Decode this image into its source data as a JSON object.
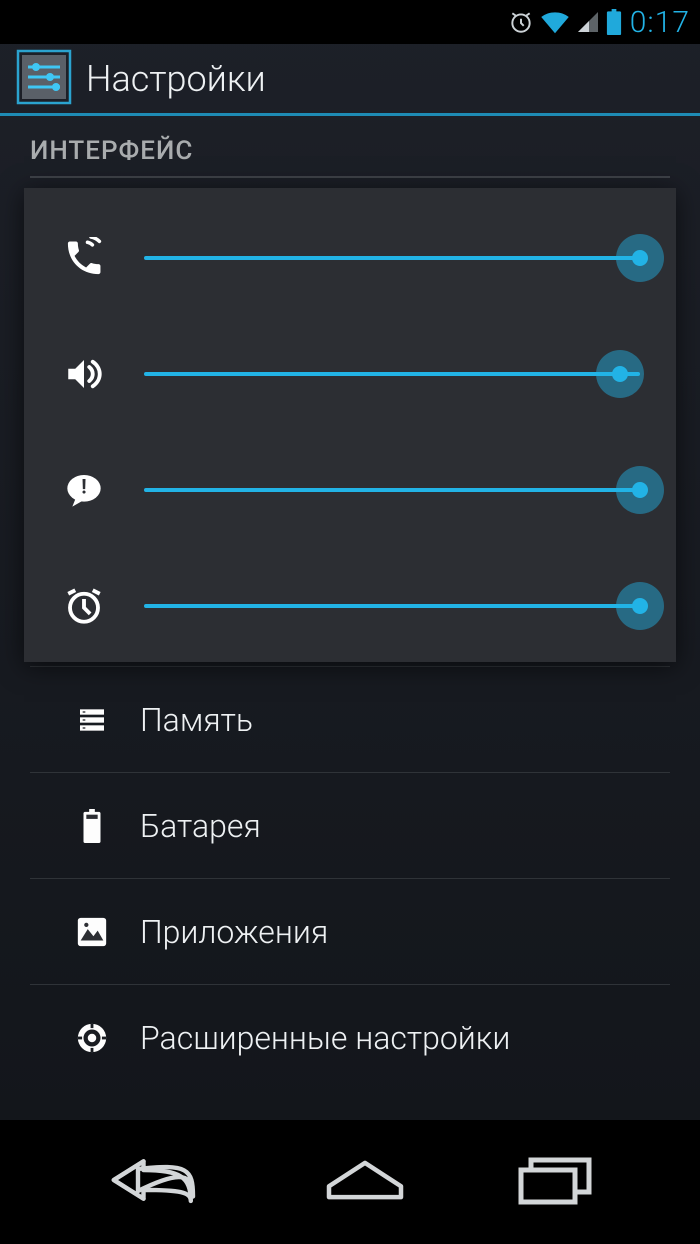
{
  "status": {
    "time": "0:17"
  },
  "titlebar": {
    "title": "Настройки"
  },
  "section": {
    "header": "ИНТЕРФЕЙС"
  },
  "volume": {
    "sliders": [
      {
        "icon": "phone",
        "value": 100
      },
      {
        "icon": "speaker",
        "value": 96
      },
      {
        "icon": "notify",
        "value": 100
      },
      {
        "icon": "alarm",
        "value": 100
      }
    ]
  },
  "list": {
    "items": [
      {
        "icon": "storage",
        "label": "Память"
      },
      {
        "icon": "battery",
        "label": "Батарея"
      },
      {
        "icon": "apps",
        "label": "Приложения"
      },
      {
        "icon": "gear",
        "label": "Расширенные настройки"
      }
    ]
  },
  "colors": {
    "accent": "#22b3e6"
  }
}
